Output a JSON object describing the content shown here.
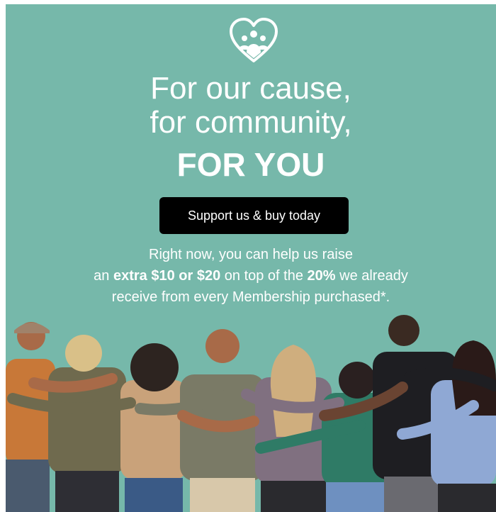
{
  "heading": {
    "line1": "For our cause,",
    "line2": "for community,",
    "line3": "FOR YOU"
  },
  "cta": {
    "label": "Support us & buy today"
  },
  "body": {
    "line1": "Right now, you can help us raise",
    "line2_a": "an ",
    "line2_b": "extra $10 or $20",
    "line2_c": " on top of the ",
    "line2_d": "20%",
    "line2_e": " we already",
    "line3": "receive from every Membership purchased*."
  },
  "icons": {
    "logo": "heart-community-icon"
  },
  "colors": {
    "background": "#76b8aa",
    "button": "#000000",
    "text": "#ffffff"
  }
}
